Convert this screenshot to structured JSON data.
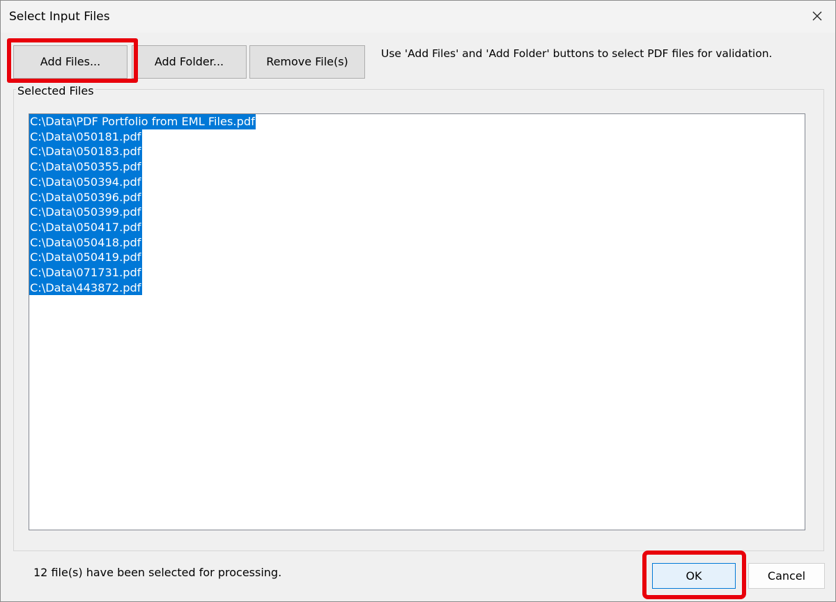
{
  "window": {
    "title": "Select Input Files",
    "close_icon": "close-icon"
  },
  "toolbar": {
    "add_files_label": "Add Files...",
    "add_folder_label": "Add Folder...",
    "remove_files_label": "Remove File(s)",
    "hint": "Use 'Add Files' and 'Add Folder' buttons to select PDF files for validation."
  },
  "selected_files": {
    "group_label": "Selected Files",
    "items": [
      "C:\\Data\\PDF Portfolio from EML Files.pdf",
      "C:\\Data\\050181.pdf",
      "C:\\Data\\050183.pdf",
      "C:\\Data\\050355.pdf",
      "C:\\Data\\050394.pdf",
      "C:\\Data\\050396.pdf",
      "C:\\Data\\050399.pdf",
      "C:\\Data\\050417.pdf",
      "C:\\Data\\050418.pdf",
      "C:\\Data\\050419.pdf",
      "C:\\Data\\071731.pdf",
      "C:\\Data\\443872.pdf"
    ],
    "selection_color": "#0078d7"
  },
  "footer": {
    "status": "12 file(s) have been selected for processing.",
    "ok_label": "OK",
    "cancel_label": "Cancel"
  },
  "annotations": {
    "highlight_color": "#e8000b"
  }
}
